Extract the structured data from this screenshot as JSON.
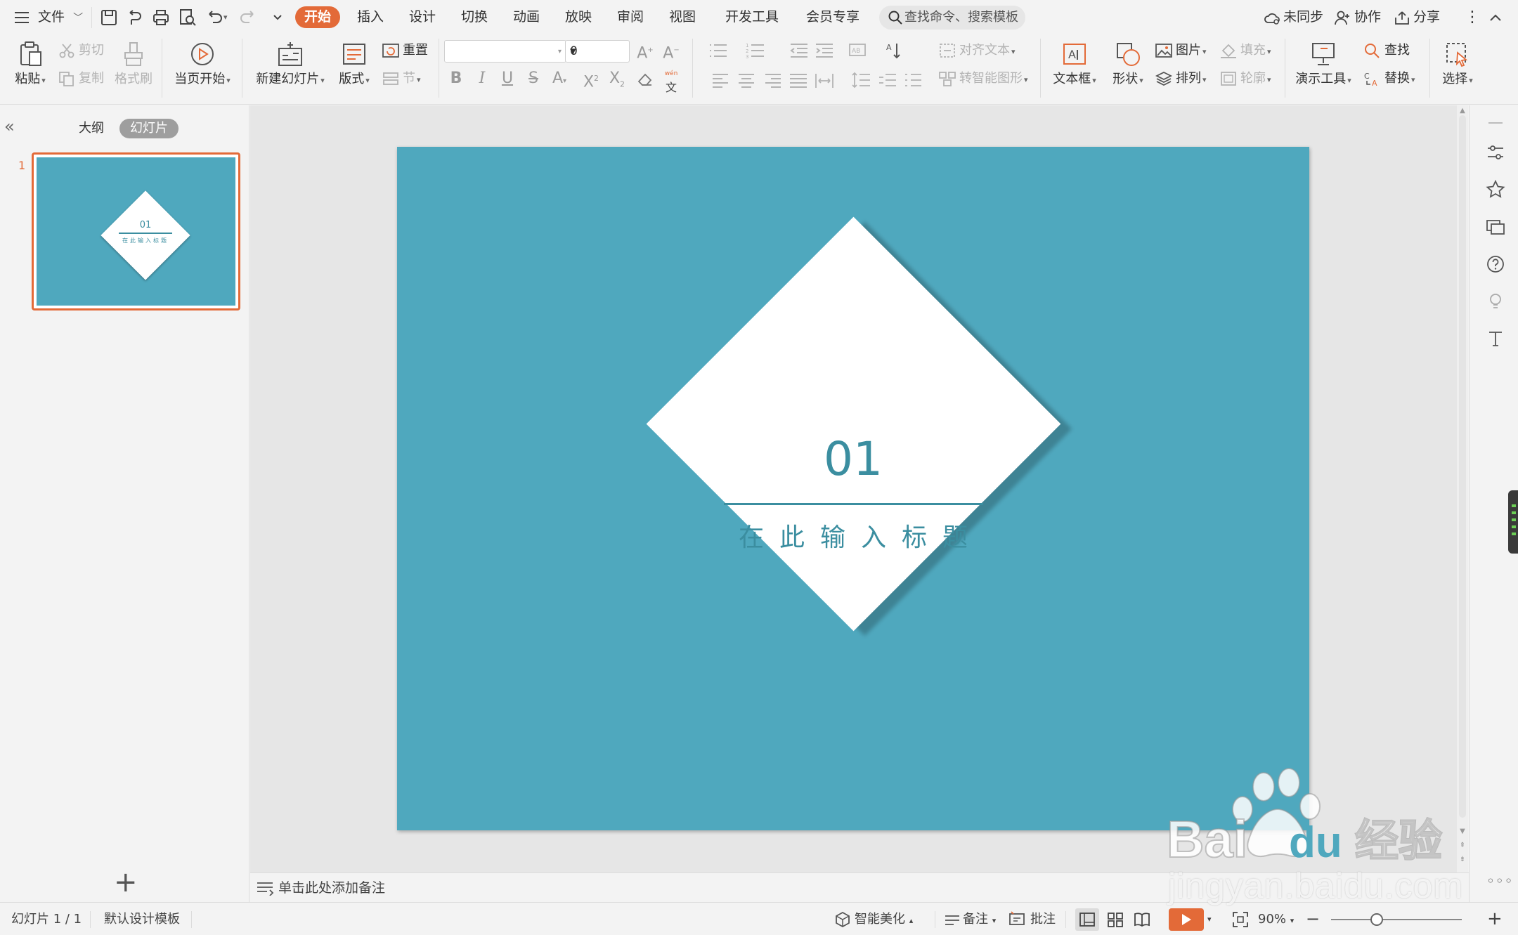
{
  "menu": {
    "file_label": "文件",
    "tabs": [
      {
        "label": "开始",
        "active": true
      },
      {
        "label": "插入"
      },
      {
        "label": "设计"
      },
      {
        "label": "切换"
      },
      {
        "label": "动画"
      },
      {
        "label": "放映"
      },
      {
        "label": "审阅"
      },
      {
        "label": "视图"
      },
      {
        "label": "开发工具"
      },
      {
        "label": "会员专享"
      }
    ],
    "search_placeholder": "查找命令、搜索模板",
    "sync_label": "未同步",
    "collab_label": "协作",
    "share_label": "分享"
  },
  "ribbon": {
    "paste": "粘贴",
    "cut": "剪切",
    "copy": "复制",
    "format_painter": "格式刷",
    "from_current": "当页开始",
    "new_slide": "新建幻灯片",
    "layout": "版式",
    "reset": "重置",
    "section": "节",
    "font_size": "0",
    "align_text": "对齐文本",
    "smartart": "转智能图形",
    "textbox": "文本框",
    "shape": "形状",
    "picture": "图片",
    "arrange": "排列",
    "fill": "填充",
    "outline": "轮廓",
    "presenter_tools": "演示工具",
    "find": "查找",
    "replace": "替换",
    "select": "选择"
  },
  "leftpanel": {
    "outline_tab": "大纲",
    "slides_tab": "幻灯片",
    "slide_number": "1",
    "add_slide_symbol": "+"
  },
  "slide": {
    "number": "01",
    "title": "在此输入标题",
    "background_color": "#4fa8be",
    "accent_color": "#3b8ea0",
    "diamond_color": "#ffffff"
  },
  "notes": {
    "placeholder": "单击此处添加备注"
  },
  "status": {
    "slide_counter": "幻灯片 1 / 1",
    "template": "默认设计模板",
    "beautify": "智能美化",
    "notes": "备注",
    "comments": "批注",
    "zoom": "90%",
    "zoom_fraction": 0.35
  },
  "watermark": {
    "logo_text": "Baidu经验",
    "url": "jingyan.baidu.com"
  },
  "theme": {
    "accent": "#e36a38"
  }
}
